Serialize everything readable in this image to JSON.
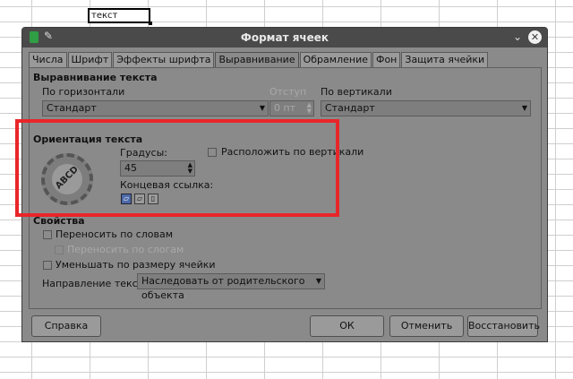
{
  "sheet": {
    "cell_text": "текст"
  },
  "dialog": {
    "title": "Формат ячеек",
    "tabs": [
      {
        "label": "Числа"
      },
      {
        "label": "Шрифт"
      },
      {
        "label": "Эффекты шрифта"
      },
      {
        "label": "Выравнивание"
      },
      {
        "label": "Обрамление"
      },
      {
        "label": "Фон"
      },
      {
        "label": "Защита ячейки"
      }
    ],
    "active_tab": "Выравнивание",
    "alignment": {
      "title": "Выравнивание текста",
      "horizontal_label": "По горизонтали",
      "horizontal_value": "Стандарт",
      "indent_label": "Отступ",
      "indent_value": "0 пт",
      "vertical_label": "По вертикали",
      "vertical_value": "Стандарт"
    },
    "orientation": {
      "title": "Ориентация текста",
      "dial_text": "ABCD",
      "degrees_label": "Градусы:",
      "degrees_value": "45",
      "stack_vertical_label": "Расположить по вертикали",
      "reference_label": "Концевая ссылка:"
    },
    "properties": {
      "title": "Свойства",
      "wrap_label": "Переносить по словам",
      "hyphen_label": "Переносить по слогам",
      "shrink_label": "Уменьшать по размеру ячейки",
      "direction_label": "Направление текста:",
      "direction_value": "Наследовать от родительского объекта"
    },
    "buttons": {
      "help": "Справка",
      "ok": "ОК",
      "cancel": "Отменить",
      "reset": "Восстановить"
    }
  },
  "colors": {
    "highlight": "#e8262a",
    "titlebar": "#4a4a4a"
  }
}
